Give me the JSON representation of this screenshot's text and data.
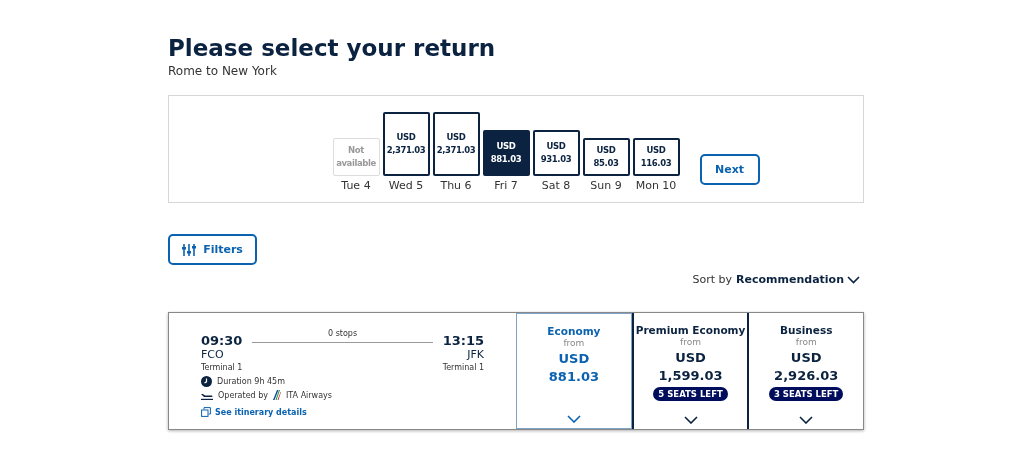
{
  "heading": {
    "title": "Please select your return",
    "route": "Rome to New York"
  },
  "dates": [
    {
      "kind": "unavailable",
      "price_lines": [
        "Not",
        "available"
      ],
      "day": "Tue 4",
      "selected": false
    },
    {
      "kind": "tall",
      "price_lines": [
        "USD",
        "2,371.03"
      ],
      "day": "Wed 5",
      "selected": false
    },
    {
      "kind": "tall",
      "price_lines": [
        "USD",
        "2,371.03"
      ],
      "day": "Thu 6",
      "selected": false
    },
    {
      "kind": "medium",
      "price_lines": [
        "USD",
        "881.03"
      ],
      "day": "Fri 7",
      "selected": true
    },
    {
      "kind": "medium",
      "price_lines": [
        "USD",
        "931.03"
      ],
      "day": "Sat 8",
      "selected": false
    },
    {
      "kind": "short",
      "price_lines": [
        "USD",
        "85.03"
      ],
      "day": "Sun 9",
      "selected": false
    },
    {
      "kind": "short",
      "price_lines": [
        "USD",
        "116.03"
      ],
      "day": "Mon 10",
      "selected": false
    }
  ],
  "next_button": "Next",
  "filters_button": "Filters",
  "sort": {
    "label": "Sort by",
    "value": "Recommendation"
  },
  "flight": {
    "depart_time": "09:30",
    "depart_airport": "FCO",
    "depart_terminal": "Terminal 1",
    "stops": "0 stops",
    "arrive_time": "13:15",
    "arrive_airport": "JFK",
    "arrive_terminal": "Terminal 1",
    "duration": "Duration 9h 45m",
    "operated_label": "Operated by",
    "airline": "ITA Airways",
    "details_link": "See itinerary details"
  },
  "fares": [
    {
      "cabin": "Economy",
      "from": "from",
      "currency": "USD",
      "price": "881.03",
      "selected": true
    },
    {
      "cabin": "Premium Economy",
      "from": "from",
      "currency": "USD",
      "price": "1,599.03",
      "seats_left": "5 SEATS LEFT",
      "selected": false
    },
    {
      "cabin": "Business",
      "from": "from",
      "currency": "USD",
      "price": "2,926.03",
      "seats_left": "3 SEATS LEFT",
      "selected": false
    }
  ]
}
